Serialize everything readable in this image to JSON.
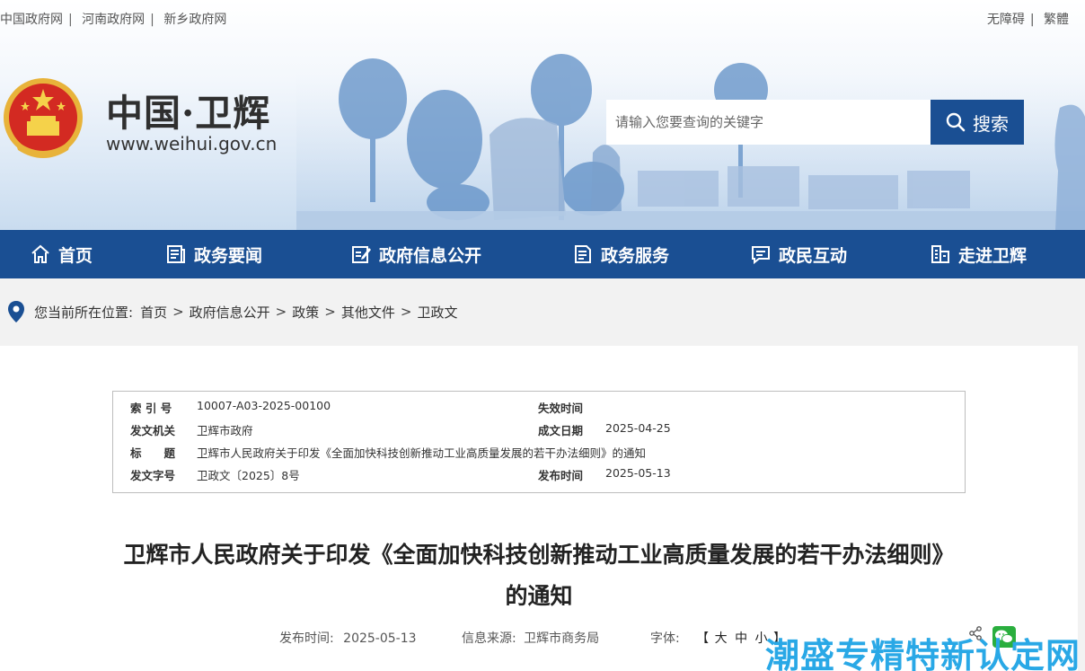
{
  "top_links": [
    "中国政府网",
    "河南政府网",
    "新乡政府网"
  ],
  "right_links": [
    "无障碍",
    "繁體"
  ],
  "site": {
    "title": "中国·卫辉",
    "url": "www.weihui.gov.cn"
  },
  "search": {
    "placeholder": "请输入您要查询的关键字",
    "button_label": "搜索"
  },
  "nav": [
    {
      "label": "首页",
      "icon": "home-icon"
    },
    {
      "label": "政务要闻",
      "icon": "news-icon"
    },
    {
      "label": "政府信息公开",
      "icon": "edit-document-icon"
    },
    {
      "label": "政务服务",
      "icon": "service-document-icon"
    },
    {
      "label": "政民互动",
      "icon": "chat-icon"
    },
    {
      "label": "走进卫辉",
      "icon": "building-icon"
    }
  ],
  "breadcrumb": {
    "prefix": "您当前所在位置:",
    "items": [
      "首页",
      "政府信息公开",
      "政策",
      "其他文件",
      "卫政文"
    ]
  },
  "meta": {
    "index_label": "索 引 号",
    "index_value": "10007-A03-2025-00100",
    "expire_label": "失效时间",
    "expire_value": "",
    "issuer_label": "发文机关",
    "issuer_value": "卫辉市政府",
    "made_label": "成文日期",
    "made_value": "2025-04-25",
    "title_label": "标　　题",
    "title_value": "卫辉市人民政府关于印发《全面加快科技创新推动工业高质量发展的若干办法细则》的通知",
    "docno_label": "发文字号",
    "docno_value": "卫政文〔2025〕8号",
    "publish_label": "发布时间",
    "publish_value": "2025-05-13"
  },
  "article": {
    "title_line1": "卫辉市人民政府关于印发《全面加快科技创新推动工业高质量发展的若干办法细则》",
    "title_line2": "的通知",
    "publish_label": "发布时间:",
    "publish_value": "2025-05-13",
    "source_label": "信息来源:",
    "source_value": "卫辉市商务局",
    "font_label": "字体:",
    "font_open": "【",
    "font_large": "大",
    "font_medium": "中",
    "font_small": "小",
    "font_close": "】"
  },
  "watermark": "潮盛专精特新认定网",
  "colors": {
    "brand": "#1a4f93",
    "watermark": "#29a8e6"
  }
}
